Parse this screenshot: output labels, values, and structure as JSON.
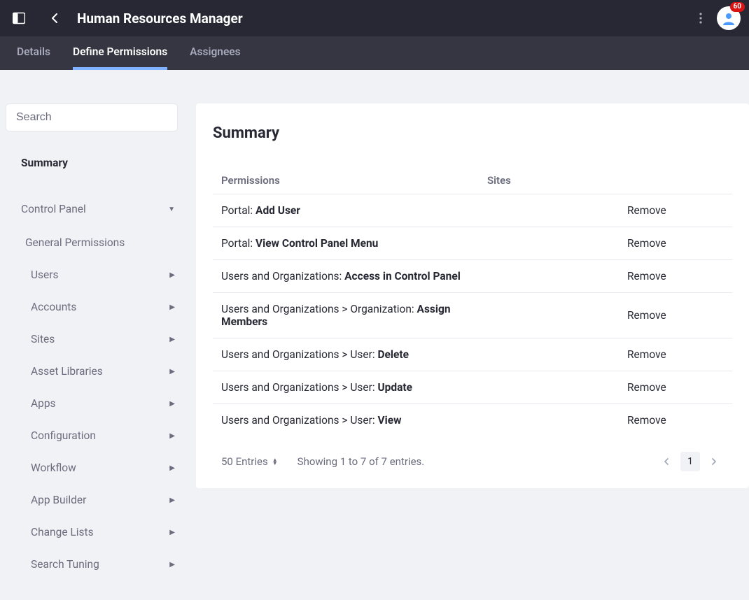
{
  "header": {
    "title": "Human Resources Manager",
    "notification_count": "60"
  },
  "tabs": [
    {
      "label": "Details"
    },
    {
      "label": "Define Permissions"
    },
    {
      "label": "Assignees"
    }
  ],
  "search": {
    "placeholder": "Search"
  },
  "sidebar": {
    "summary_label": "Summary",
    "section_label": "Control Panel",
    "items": [
      {
        "label": "General Permissions",
        "has_children": false
      },
      {
        "label": "Users",
        "has_children": true
      },
      {
        "label": "Accounts",
        "has_children": true
      },
      {
        "label": "Sites",
        "has_children": true
      },
      {
        "label": "Asset Libraries",
        "has_children": true
      },
      {
        "label": "Apps",
        "has_children": true
      },
      {
        "label": "Configuration",
        "has_children": true
      },
      {
        "label": "Workflow",
        "has_children": true
      },
      {
        "label": "App Builder",
        "has_children": true
      },
      {
        "label": "Change Lists",
        "has_children": true
      },
      {
        "label": "Search Tuning",
        "has_children": true
      }
    ]
  },
  "main": {
    "heading": "Summary",
    "columns": {
      "permissions": "Permissions",
      "sites": "Sites"
    },
    "rows": [
      {
        "prefix": "Portal: ",
        "bold": "Add User",
        "remove": "Remove"
      },
      {
        "prefix": "Portal: ",
        "bold": "View Control Panel Menu",
        "remove": "Remove"
      },
      {
        "prefix": "Users and Organizations: ",
        "bold": "Access in Control Panel",
        "remove": "Remove"
      },
      {
        "prefix": "Users and Organizations > Organization: ",
        "bold": "Assign Members",
        "remove": "Remove"
      },
      {
        "prefix": "Users and Organizations > User: ",
        "bold": "Delete",
        "remove": "Remove"
      },
      {
        "prefix": "Users and Organizations > User: ",
        "bold": "Update",
        "remove": "Remove"
      },
      {
        "prefix": "Users and Organizations > User: ",
        "bold": "View",
        "remove": "Remove"
      }
    ],
    "footer": {
      "entries_label": "50 Entries",
      "showing": "Showing 1 to 7 of 7 entries.",
      "current_page": "1"
    }
  }
}
